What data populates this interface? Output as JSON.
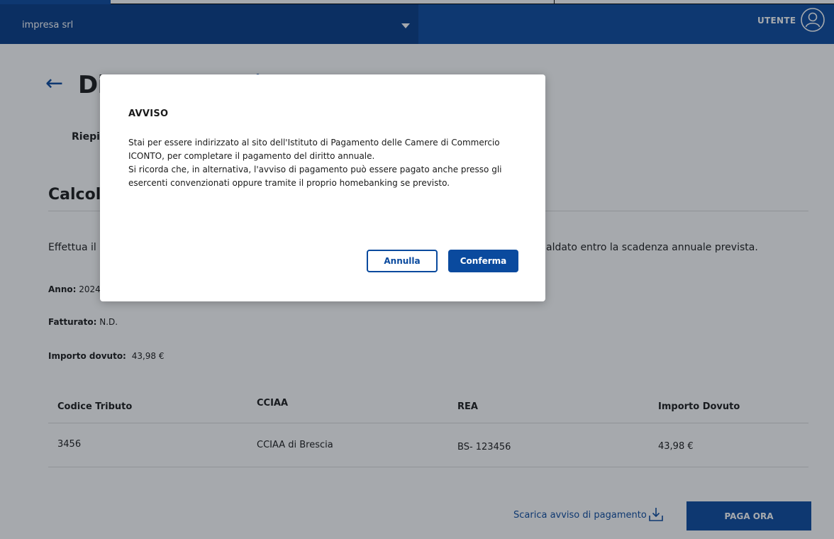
{
  "topbar": {
    "company": "impresa srl",
    "user_label": "UTENTE",
    "icons": {
      "caret": "chevron-down-icon",
      "avatar": "user-icon"
    }
  },
  "header": {
    "title": "Di",
    "tab": "Riepil"
  },
  "section": {
    "title": "Calcol",
    "intro_start": "Effettua il",
    "intro_end": "aldato entro la scadenza annuale prevista."
  },
  "fields": {
    "anno_label": "Anno:",
    "anno_value": "2024",
    "fatturato_label": "Fatturato:",
    "fatturato_value": "N.D.",
    "importo_label": "Importo dovuto:",
    "importo_value": "43,98 €"
  },
  "table": {
    "headers": [
      "Codice Tributo",
      "CCIAA",
      "REA",
      "Importo Dovuto"
    ],
    "rows": [
      [
        "3456",
        "CCIAA di Brescia",
        "BS- 123456",
        "43,98 €"
      ]
    ]
  },
  "actions": {
    "download_label": "Scarica avviso di pagamento",
    "download_icon": "download-icon",
    "pay_label": "PAGA ORA"
  },
  "modal": {
    "title": "AVVISO",
    "line1": "Stai per essere indirizzato al sito dell'Istituto di Pagamento delle Camere di Commercio",
    "line2": "ICONTO, per completare il pagamento del diritto annuale.",
    "line3": "Si ricorda che, in alternativa, l'avviso di pagamento può essere pagato anche presso gli",
    "line4": "esercenti convenzionati oppure tramite il proprio homebanking se previsto.",
    "cancel_label": "Annulla",
    "confirm_label": "Conferma"
  },
  "colors": {
    "primary": "#0a4a9e",
    "topbar_dark": "#063a86",
    "overlay": "rgba(20,28,40,0.38)"
  }
}
